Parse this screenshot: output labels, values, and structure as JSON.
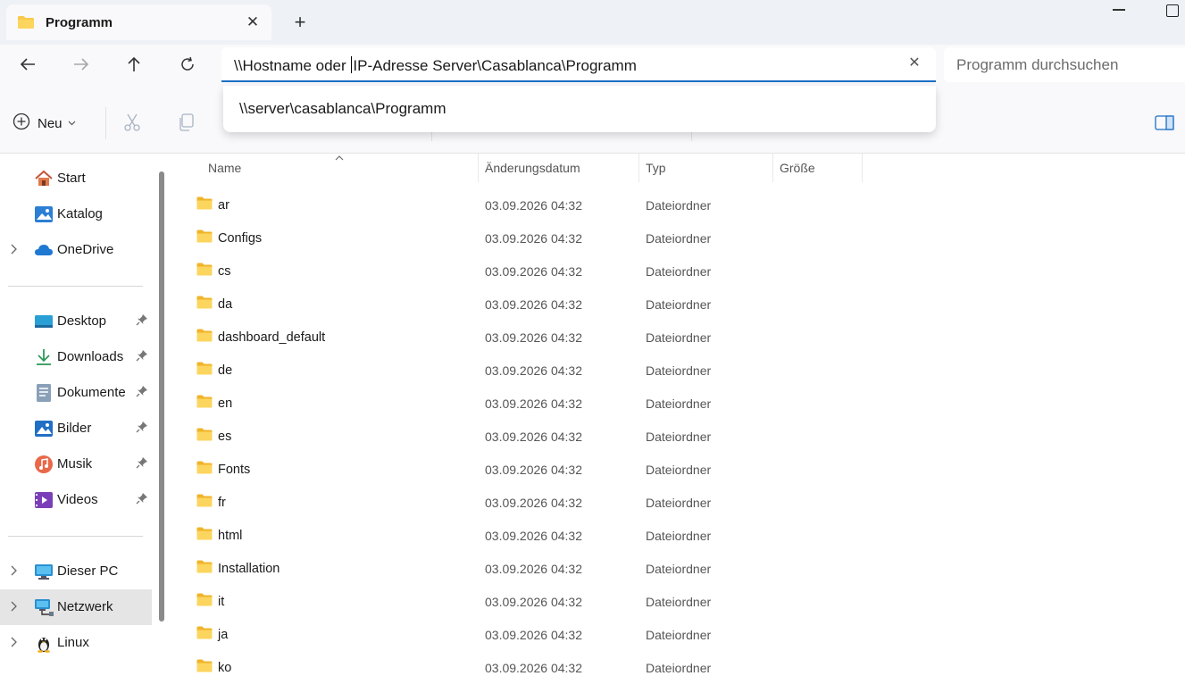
{
  "tab": {
    "title": "Programm",
    "close": "✕",
    "new": "+"
  },
  "address": {
    "value_before_caret": "\\\\Hostname oder ",
    "value_after_caret": "IP-Adresse Server\\Casablanca\\Programm",
    "clear": "✕",
    "suggestion": "\\\\server\\casablanca\\Programm"
  },
  "search": {
    "placeholder": "Programm durchsuchen"
  },
  "toolbar": {
    "new_label": "Neu"
  },
  "sidebar": {
    "items": [
      {
        "label": "Start",
        "icon": "home-icon"
      },
      {
        "label": "Katalog",
        "icon": "gallery-icon"
      },
      {
        "label": "OneDrive",
        "icon": "cloud-icon"
      },
      {
        "label": "Desktop",
        "icon": "desktop-icon"
      },
      {
        "label": "Downloads",
        "icon": "download-icon"
      },
      {
        "label": "Dokumente",
        "icon": "document-icon"
      },
      {
        "label": "Bilder",
        "icon": "picture-icon"
      },
      {
        "label": "Musik",
        "icon": "music-icon"
      },
      {
        "label": "Videos",
        "icon": "video-icon"
      },
      {
        "label": "Dieser PC",
        "icon": "computer-icon"
      },
      {
        "label": "Netzwerk",
        "icon": "network-icon"
      },
      {
        "label": "Linux",
        "icon": "linux-icon"
      }
    ]
  },
  "columns": {
    "name": "Name",
    "date": "Änderungsdatum",
    "type": "Typ",
    "size": "Größe"
  },
  "files": [
    {
      "name": "ar",
      "date": "03.09.2026 04:32",
      "type": "Dateiordner"
    },
    {
      "name": "Configs",
      "date": "03.09.2026 04:32",
      "type": "Dateiordner"
    },
    {
      "name": "cs",
      "date": "03.09.2026 04:32",
      "type": "Dateiordner"
    },
    {
      "name": "da",
      "date": "03.09.2026 04:32",
      "type": "Dateiordner"
    },
    {
      "name": "dashboard_default",
      "date": "03.09.2026 04:32",
      "type": "Dateiordner"
    },
    {
      "name": "de",
      "date": "03.09.2026 04:32",
      "type": "Dateiordner"
    },
    {
      "name": "en",
      "date": "03.09.2026 04:32",
      "type": "Dateiordner"
    },
    {
      "name": "es",
      "date": "03.09.2026 04:32",
      "type": "Dateiordner"
    },
    {
      "name": "Fonts",
      "date": "03.09.2026 04:32",
      "type": "Dateiordner"
    },
    {
      "name": "fr",
      "date": "03.09.2026 04:32",
      "type": "Dateiordner"
    },
    {
      "name": "html",
      "date": "03.09.2026 04:32",
      "type": "Dateiordner"
    },
    {
      "name": "Installation",
      "date": "03.09.2026 04:32",
      "type": "Dateiordner"
    },
    {
      "name": "it",
      "date": "03.09.2026 04:32",
      "type": "Dateiordner"
    },
    {
      "name": "ja",
      "date": "03.09.2026 04:32",
      "type": "Dateiordner"
    },
    {
      "name": "ko",
      "date": "03.09.2026 04:32",
      "type": "Dateiordner"
    }
  ],
  "colors": {
    "accent": "#1a6fc4",
    "folder": "#f8c94a",
    "selected": "#e5e5e5"
  }
}
